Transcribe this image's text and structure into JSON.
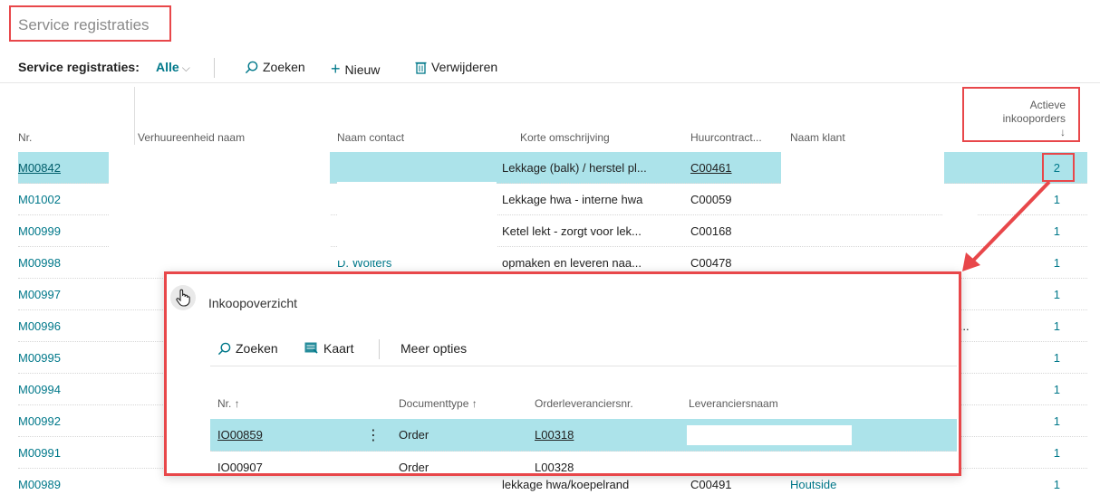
{
  "page": {
    "title": "Service registraties"
  },
  "actionbar": {
    "label": "Service registraties:",
    "filter": "Alle",
    "search": "Zoeken",
    "new": "Nieuw",
    "delete": "Verwijderen"
  },
  "columns": {
    "nr": "Nr.",
    "unit": "Verhuureenheid naam",
    "contact": "Naam contact",
    "desc": "Korte omschrijving",
    "contract": "Huurcontract...",
    "customer": "Naam klant",
    "active_line1": "Actieve",
    "active_line2": "inkooporders",
    "active_sort": "↓"
  },
  "rows": [
    {
      "nr": "M00842",
      "desc": "Lekkage (balk) / herstel pl...",
      "contract": "C00461",
      "count": "2"
    },
    {
      "nr": "M01002",
      "desc": "Lekkage hwa - interne hwa",
      "contract": "C00059",
      "count": "1"
    },
    {
      "nr": "M00999",
      "desc": "Ketel lekt - zorgt voor lek...",
      "contract": "C00168",
      "count": "1"
    },
    {
      "nr": "M00998",
      "contact": "D. Wolters",
      "desc": "opmaken en leveren naa...",
      "contract": "C00478",
      "count": "1"
    },
    {
      "nr": "M00997",
      "count": "1"
    },
    {
      "nr": "M00996",
      "customer": "dy...",
      "count": "1"
    },
    {
      "nr": "M00995",
      "count": "1"
    },
    {
      "nr": "M00994",
      "count": "1"
    },
    {
      "nr": "M00992",
      "count": "1"
    },
    {
      "nr": "M00991",
      "count": "1"
    },
    {
      "nr": "M00989",
      "desc": "lekkage hwa/koepelrand",
      "contract": "C00491",
      "customer": "Houtside",
      "count": "1"
    }
  ],
  "popup": {
    "title": "Inkoopoverzicht",
    "search": "Zoeken",
    "card": "Kaart",
    "more": "Meer opties",
    "columns": {
      "nr": "Nr. ↑",
      "doctype": "Documenttype ↑",
      "vendor_nr": "Orderleveranciersnr.",
      "vendor_name": "Leveranciersnaam"
    },
    "rows": [
      {
        "nr": "IO00859",
        "doctype": "Order",
        "vendor_nr": "L00318"
      },
      {
        "nr": "IO00907",
        "doctype": "Order",
        "vendor_nr": "L00328"
      }
    ]
  },
  "colors": {
    "accent": "#00788a",
    "selected_row": "#ace3ea",
    "annotation": "#e8474a"
  }
}
